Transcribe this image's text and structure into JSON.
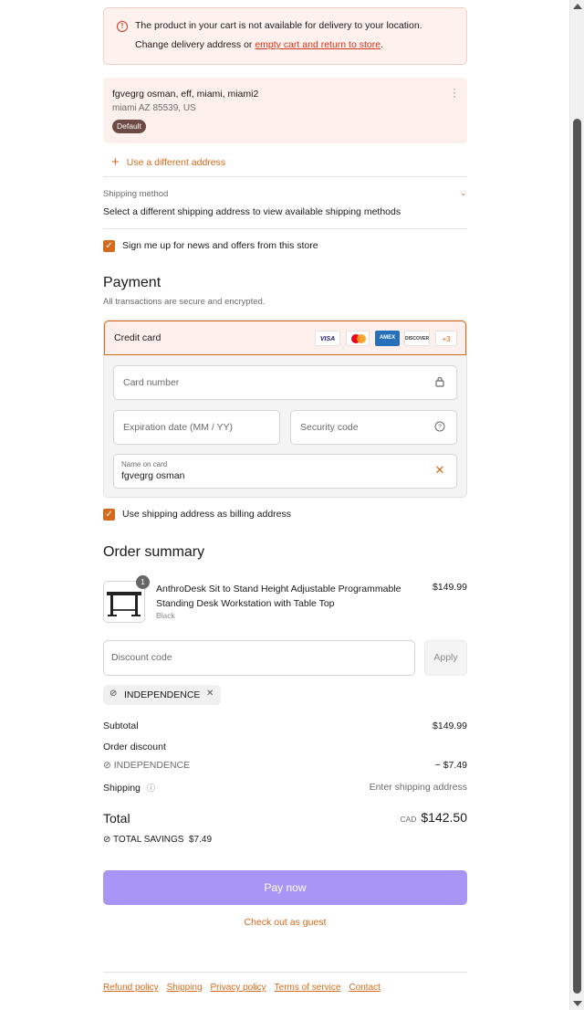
{
  "banner": {
    "line1": "The product in your cart is not available for delivery to your location.",
    "line2_prefix": "Change delivery address or ",
    "line2_link": "empty cart and return to store",
    "line2_suffix": "."
  },
  "address": {
    "name_line": "fgvegrg osman, eff, miami, miami2",
    "city_line": "miami AZ 85539, US",
    "badge": "Default"
  },
  "use_different_address": "Use a different address",
  "shipping": {
    "label": "Shipping method",
    "message": "Select a different shipping address to view available shipping methods"
  },
  "newsletter": {
    "label": "Sign me up for news and offers from this store",
    "checked": true
  },
  "payment": {
    "title": "Payment",
    "subtitle": "All transactions are secure and encrypted.",
    "method_label": "Credit card",
    "card_brands": [
      "VISA",
      "mastercard",
      "AMEX",
      "DISCOVER"
    ],
    "more_brands": "+3",
    "card_number_placeholder": "Card number",
    "expiry_placeholder": "Expiration date (MM / YY)",
    "security_placeholder": "Security code",
    "name_label": "Name on card",
    "name_value": "fgvegrg osman"
  },
  "billing": {
    "label": "Use shipping address as billing address",
    "checked": true
  },
  "summary": {
    "title": "Order summary",
    "product": {
      "quantity": "1",
      "name": "AnthroDesk Sit to Stand Height Adjustable Programmable Standing Desk Workstation with Table Top",
      "variant": "Black",
      "price": "$149.99"
    },
    "discount_placeholder": "Discount code",
    "apply_label": "Apply",
    "applied_code": "INDEPENDENCE",
    "subtotal_label": "Subtotal",
    "subtotal_value": "$149.99",
    "order_discount_label": "Order discount",
    "discount_code": "INDEPENDENCE",
    "discount_value": "− $7.49",
    "shipping_label": "Shipping",
    "shipping_value": "Enter shipping address",
    "total_label": "Total",
    "total_currency": "CAD",
    "total_value": "$142.50",
    "savings_label": "TOTAL SAVINGS",
    "savings_value": "$7.49"
  },
  "pay_now": "Pay now",
  "guest_checkout": "Check out as guest",
  "footer_links": [
    "Refund policy",
    "Shipping",
    "Privacy policy",
    "Terms of service",
    "Contact"
  ],
  "colors": {
    "accent": "#d46b1c",
    "error": "#d0361b",
    "pay_button": "#a796f5",
    "address_bg": "#fdf0ec",
    "badge_bg": "#6e4a45"
  }
}
